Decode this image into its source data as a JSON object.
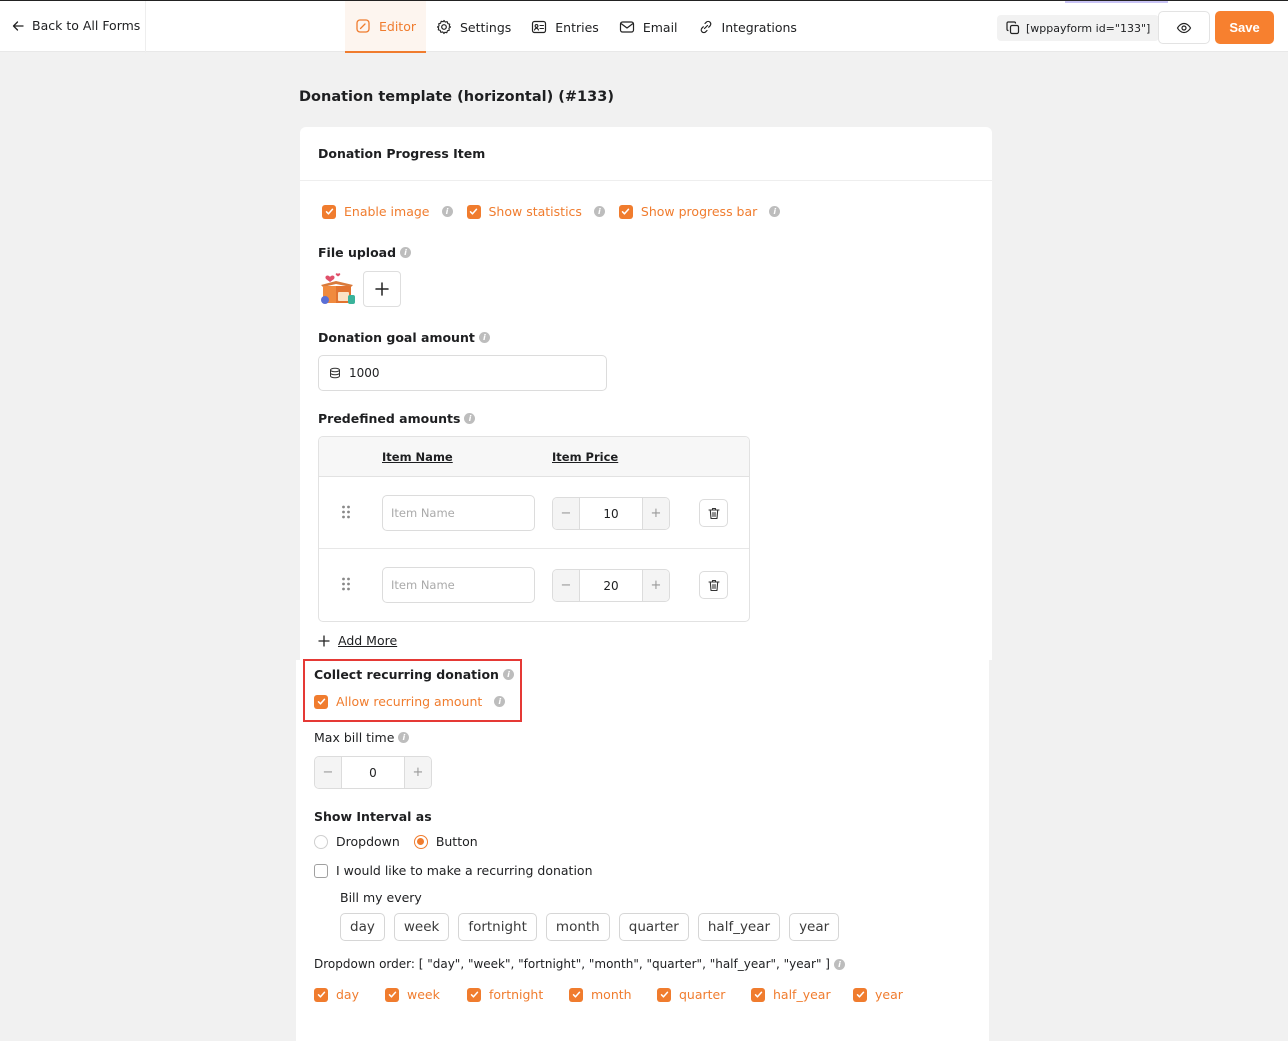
{
  "topbar": {
    "back_label": "Back to All Forms",
    "tabs": [
      {
        "label": "Editor",
        "icon": "editor-icon",
        "active": true
      },
      {
        "label": "Settings",
        "icon": "gear-icon",
        "active": false
      },
      {
        "label": "Entries",
        "icon": "entries-icon",
        "active": false
      },
      {
        "label": "Email",
        "icon": "mail-icon",
        "active": false
      },
      {
        "label": "Integrations",
        "icon": "link-icon",
        "active": false
      }
    ],
    "shortcode": "[wppayform id=\"133\"]",
    "save_label": "Save"
  },
  "page": {
    "title": "Donation template (horizontal) (#133)"
  },
  "progress_card": {
    "title": "Donation Progress Item",
    "options": [
      {
        "label": "Enable image",
        "checked": true
      },
      {
        "label": "Show statistics",
        "checked": true
      },
      {
        "label": "Show progress bar",
        "checked": true
      }
    ],
    "file_upload_label": "File upload",
    "goal_label": "Donation goal amount",
    "goal_value": "1000",
    "predefined_label": "Predefined amounts",
    "table": {
      "col_name": "Item Name",
      "col_price": "Item Price",
      "rows": [
        {
          "name_placeholder": "Item Name",
          "price": "10"
        },
        {
          "name_placeholder": "Item Name",
          "price": "20"
        }
      ]
    },
    "add_more_label": "Add More"
  },
  "recurring": {
    "section_label": "Collect recurring donation",
    "allow_label": "Allow recurring amount",
    "allow_checked": true,
    "max_bill_label": "Max bill time",
    "max_bill_value": "0",
    "show_interval_label": "Show Interval as",
    "interval_modes": [
      {
        "label": "Dropdown",
        "selected": false
      },
      {
        "label": "Button",
        "selected": true
      }
    ],
    "recurring_checkbox_label": "I would like to make a recurring donation",
    "bill_my_every_label": "Bill my every",
    "intervals": [
      "day",
      "week",
      "fortnight",
      "month",
      "quarter",
      "half_year",
      "year"
    ],
    "dropdown_order_label": "Dropdown order: [ \"day\", \"week\", \"fortnight\", \"month\", \"quarter\", \"half_year\", \"year\" ]",
    "order_options": [
      "day",
      "week",
      "fortnight",
      "month",
      "quarter",
      "half_year",
      "year"
    ]
  },
  "colors": {
    "accent": "#f07c2e",
    "highlight_border": "#e53935"
  }
}
